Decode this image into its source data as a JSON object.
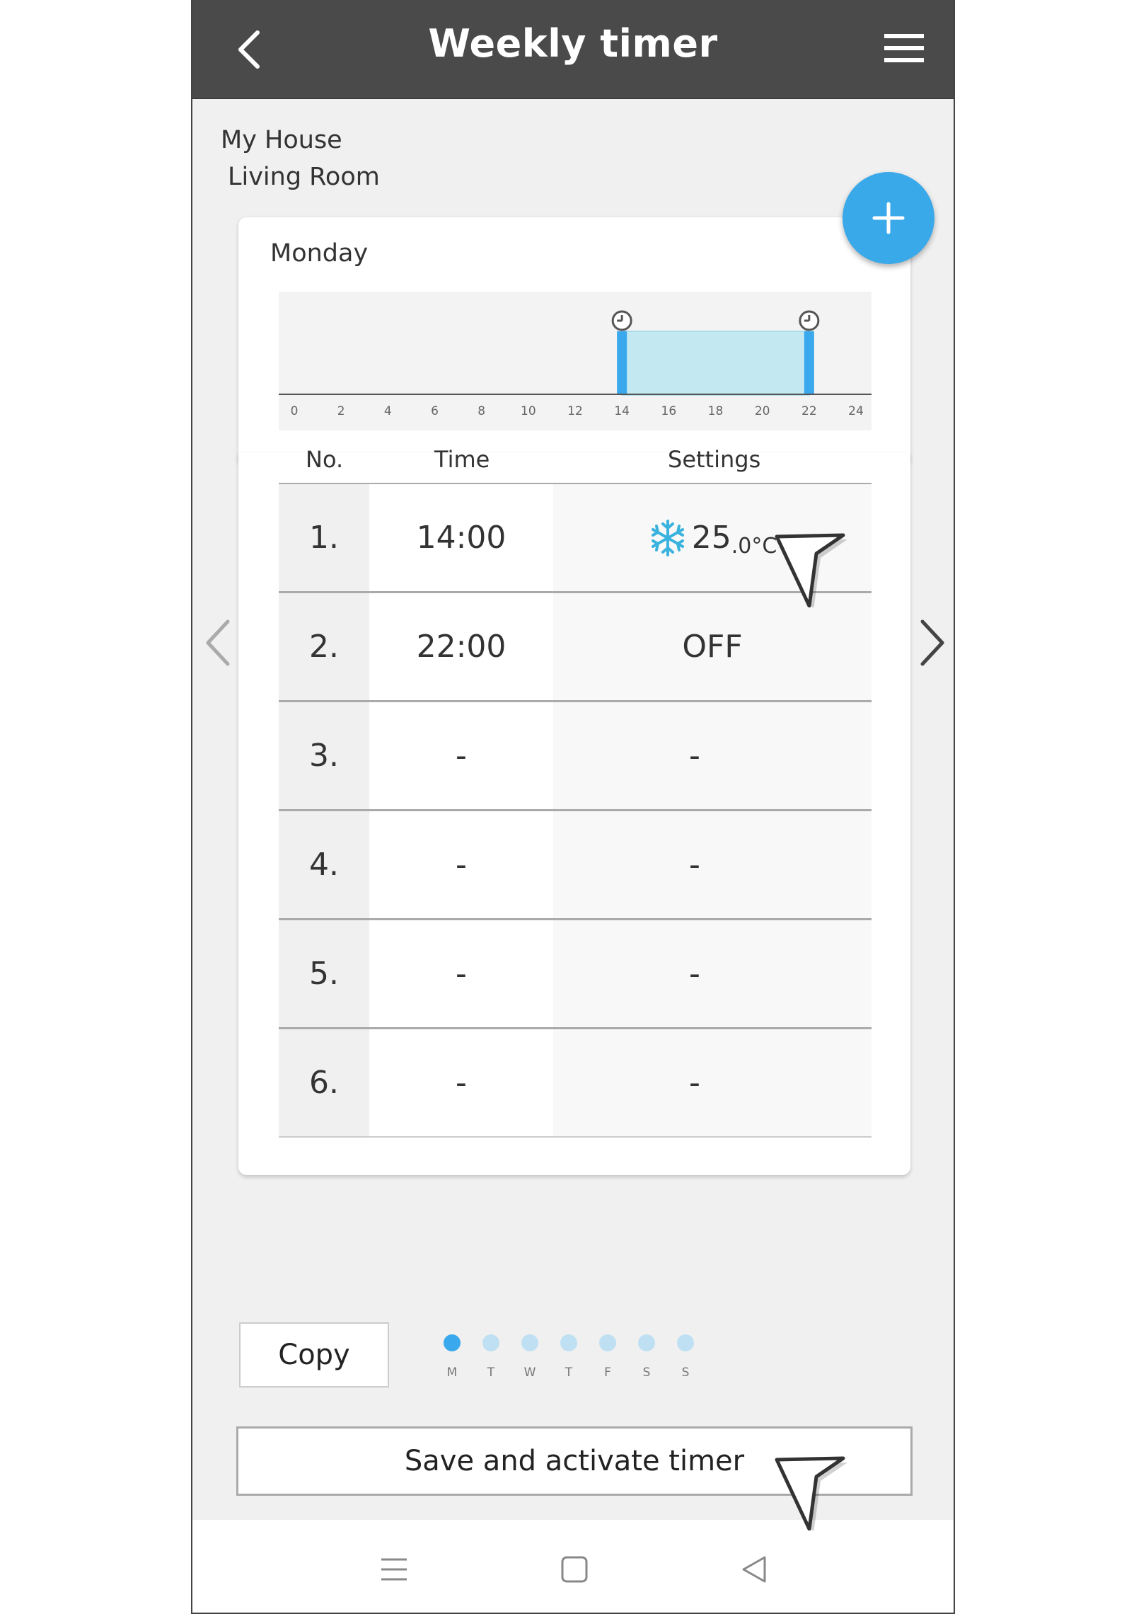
{
  "header": {
    "title": "Weekly timer"
  },
  "location": {
    "house": "My House",
    "room": "Living Room"
  },
  "day": {
    "name": "Monday"
  },
  "timeline": {
    "ticks": [
      "0",
      "2",
      "4",
      "6",
      "8",
      "10",
      "12",
      "14",
      "16",
      "18",
      "20",
      "22",
      "24"
    ],
    "active_start_hour": 14,
    "active_end_hour": 22
  },
  "schedule": {
    "headers": {
      "no": "No.",
      "time": "Time",
      "settings": "Settings"
    },
    "rows": [
      {
        "no": "1.",
        "time": "14:00",
        "temp_int": "25",
        "temp_dec": ".0",
        "unit": "°C",
        "mode_icon": "snowflake-icon"
      },
      {
        "no": "2.",
        "time": "22:00",
        "setting": "OFF"
      },
      {
        "no": "3.",
        "time": "-",
        "setting": "-"
      },
      {
        "no": "4.",
        "time": "-",
        "setting": "-"
      },
      {
        "no": "5.",
        "time": "-",
        "setting": "-"
      },
      {
        "no": "6.",
        "time": "-",
        "setting": "-"
      }
    ]
  },
  "footer": {
    "copy_label": "Copy",
    "save_label": "Save and activate timer",
    "days": [
      "M",
      "T",
      "W",
      "T",
      "F",
      "S",
      "S"
    ],
    "active_day_index": 0
  },
  "colors": {
    "header_bg": "#4a4a4a",
    "accent": "#39a9ea",
    "active_fill": "#c3e8f2",
    "dot_inactive": "#bfe0f3"
  }
}
